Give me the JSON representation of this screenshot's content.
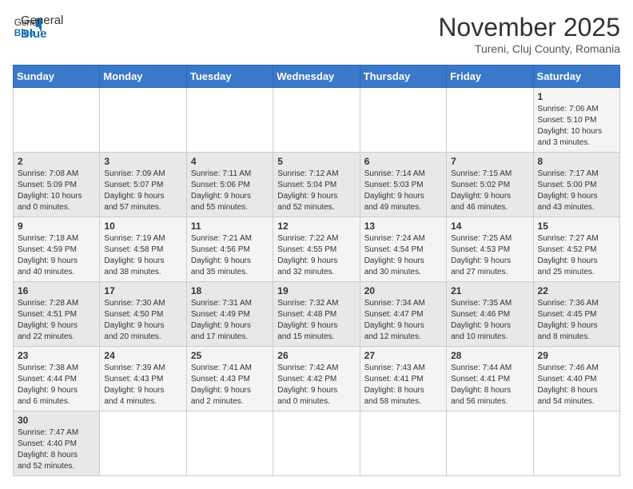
{
  "header": {
    "logo_general": "General",
    "logo_blue": "Blue",
    "month_title": "November 2025",
    "location": "Tureni, Cluj County, Romania"
  },
  "weekdays": [
    "Sunday",
    "Monday",
    "Tuesday",
    "Wednesday",
    "Thursday",
    "Friday",
    "Saturday"
  ],
  "weeks": [
    [
      {
        "day": "",
        "info": ""
      },
      {
        "day": "",
        "info": ""
      },
      {
        "day": "",
        "info": ""
      },
      {
        "day": "",
        "info": ""
      },
      {
        "day": "",
        "info": ""
      },
      {
        "day": "",
        "info": ""
      },
      {
        "day": "1",
        "info": "Sunrise: 7:06 AM\nSunset: 5:10 PM\nDaylight: 10 hours\nand 3 minutes."
      }
    ],
    [
      {
        "day": "2",
        "info": "Sunrise: 7:08 AM\nSunset: 5:09 PM\nDaylight: 10 hours\nand 0 minutes."
      },
      {
        "day": "3",
        "info": "Sunrise: 7:09 AM\nSunset: 5:07 PM\nDaylight: 9 hours\nand 57 minutes."
      },
      {
        "day": "4",
        "info": "Sunrise: 7:11 AM\nSunset: 5:06 PM\nDaylight: 9 hours\nand 55 minutes."
      },
      {
        "day": "5",
        "info": "Sunrise: 7:12 AM\nSunset: 5:04 PM\nDaylight: 9 hours\nand 52 minutes."
      },
      {
        "day": "6",
        "info": "Sunrise: 7:14 AM\nSunset: 5:03 PM\nDaylight: 9 hours\nand 49 minutes."
      },
      {
        "day": "7",
        "info": "Sunrise: 7:15 AM\nSunset: 5:02 PM\nDaylight: 9 hours\nand 46 minutes."
      },
      {
        "day": "8",
        "info": "Sunrise: 7:17 AM\nSunset: 5:00 PM\nDaylight: 9 hours\nand 43 minutes."
      }
    ],
    [
      {
        "day": "9",
        "info": "Sunrise: 7:18 AM\nSunset: 4:59 PM\nDaylight: 9 hours\nand 40 minutes."
      },
      {
        "day": "10",
        "info": "Sunrise: 7:19 AM\nSunset: 4:58 PM\nDaylight: 9 hours\nand 38 minutes."
      },
      {
        "day": "11",
        "info": "Sunrise: 7:21 AM\nSunset: 4:56 PM\nDaylight: 9 hours\nand 35 minutes."
      },
      {
        "day": "12",
        "info": "Sunrise: 7:22 AM\nSunset: 4:55 PM\nDaylight: 9 hours\nand 32 minutes."
      },
      {
        "day": "13",
        "info": "Sunrise: 7:24 AM\nSunset: 4:54 PM\nDaylight: 9 hours\nand 30 minutes."
      },
      {
        "day": "14",
        "info": "Sunrise: 7:25 AM\nSunset: 4:53 PM\nDaylight: 9 hours\nand 27 minutes."
      },
      {
        "day": "15",
        "info": "Sunrise: 7:27 AM\nSunset: 4:52 PM\nDaylight: 9 hours\nand 25 minutes."
      }
    ],
    [
      {
        "day": "16",
        "info": "Sunrise: 7:28 AM\nSunset: 4:51 PM\nDaylight: 9 hours\nand 22 minutes."
      },
      {
        "day": "17",
        "info": "Sunrise: 7:30 AM\nSunset: 4:50 PM\nDaylight: 9 hours\nand 20 minutes."
      },
      {
        "day": "18",
        "info": "Sunrise: 7:31 AM\nSunset: 4:49 PM\nDaylight: 9 hours\nand 17 minutes."
      },
      {
        "day": "19",
        "info": "Sunrise: 7:32 AM\nSunset: 4:48 PM\nDaylight: 9 hours\nand 15 minutes."
      },
      {
        "day": "20",
        "info": "Sunrise: 7:34 AM\nSunset: 4:47 PM\nDaylight: 9 hours\nand 12 minutes."
      },
      {
        "day": "21",
        "info": "Sunrise: 7:35 AM\nSunset: 4:46 PM\nDaylight: 9 hours\nand 10 minutes."
      },
      {
        "day": "22",
        "info": "Sunrise: 7:36 AM\nSunset: 4:45 PM\nDaylight: 9 hours\nand 8 minutes."
      }
    ],
    [
      {
        "day": "23",
        "info": "Sunrise: 7:38 AM\nSunset: 4:44 PM\nDaylight: 9 hours\nand 6 minutes."
      },
      {
        "day": "24",
        "info": "Sunrise: 7:39 AM\nSunset: 4:43 PM\nDaylight: 9 hours\nand 4 minutes."
      },
      {
        "day": "25",
        "info": "Sunrise: 7:41 AM\nSunset: 4:43 PM\nDaylight: 9 hours\nand 2 minutes."
      },
      {
        "day": "26",
        "info": "Sunrise: 7:42 AM\nSunset: 4:42 PM\nDaylight: 9 hours\nand 0 minutes."
      },
      {
        "day": "27",
        "info": "Sunrise: 7:43 AM\nSunset: 4:41 PM\nDaylight: 8 hours\nand 58 minutes."
      },
      {
        "day": "28",
        "info": "Sunrise: 7:44 AM\nSunset: 4:41 PM\nDaylight: 8 hours\nand 56 minutes."
      },
      {
        "day": "29",
        "info": "Sunrise: 7:46 AM\nSunset: 4:40 PM\nDaylight: 8 hours\nand 54 minutes."
      }
    ],
    [
      {
        "day": "30",
        "info": "Sunrise: 7:47 AM\nSunset: 4:40 PM\nDaylight: 8 hours\nand 52 minutes."
      },
      {
        "day": "",
        "info": ""
      },
      {
        "day": "",
        "info": ""
      },
      {
        "day": "",
        "info": ""
      },
      {
        "day": "",
        "info": ""
      },
      {
        "day": "",
        "info": ""
      },
      {
        "day": "",
        "info": ""
      }
    ]
  ]
}
